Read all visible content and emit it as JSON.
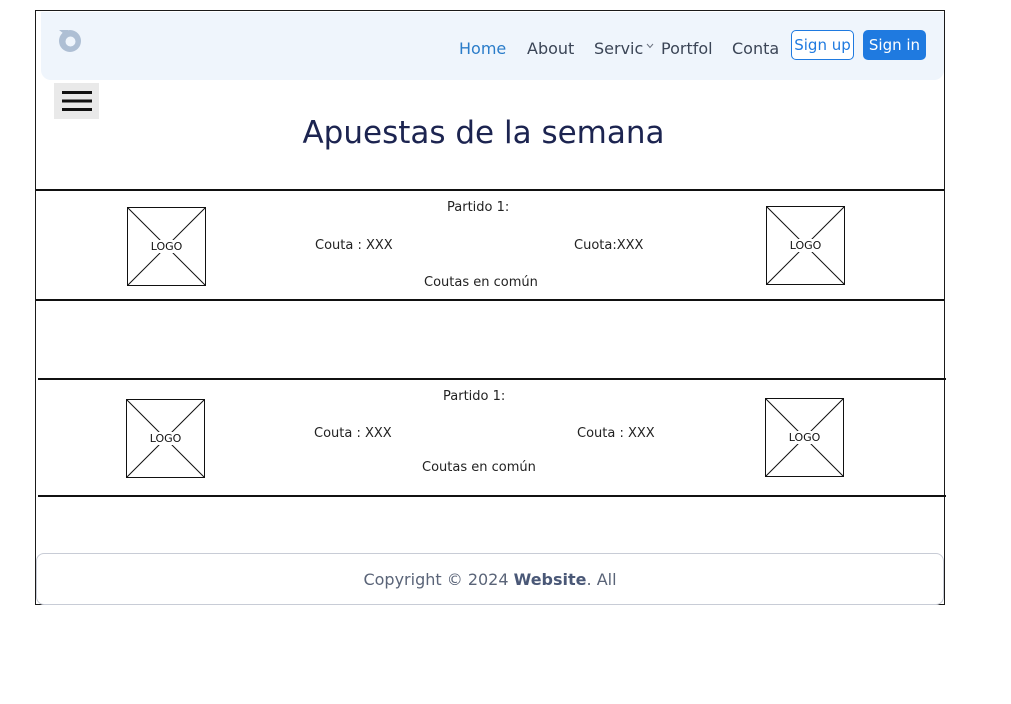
{
  "navbar": {
    "links": [
      {
        "label": "Home"
      },
      {
        "label": "About"
      },
      {
        "label": "Servic"
      },
      {
        "label": "Portfol"
      },
      {
        "label": "Conta"
      }
    ],
    "signup_label": "Sign up",
    "signin_label": "Sign in"
  },
  "page": {
    "title": "Apuestas de la semana"
  },
  "matches": [
    {
      "title": "Partido 1:",
      "left_odds": "Couta : XXX",
      "right_odds": "Cuota:XXX",
      "common": "Coutas en común",
      "left_logo": "LOGO",
      "right_logo": "LOGO"
    },
    {
      "title": "Partido 1:",
      "left_odds": "Couta : XXX",
      "right_odds": "Couta : XXX",
      "common": "Coutas en común",
      "left_logo": "LOGO",
      "right_logo": "LOGO"
    }
  ],
  "footer": {
    "prefix": "Copyright © 2024 ",
    "site": "Website",
    "suffix": ". All"
  },
  "colors": {
    "accent": "#1f7ae0",
    "active_link": "#2a7cc9",
    "title": "#1c2450",
    "navbar_bg": "#eff5fc"
  }
}
